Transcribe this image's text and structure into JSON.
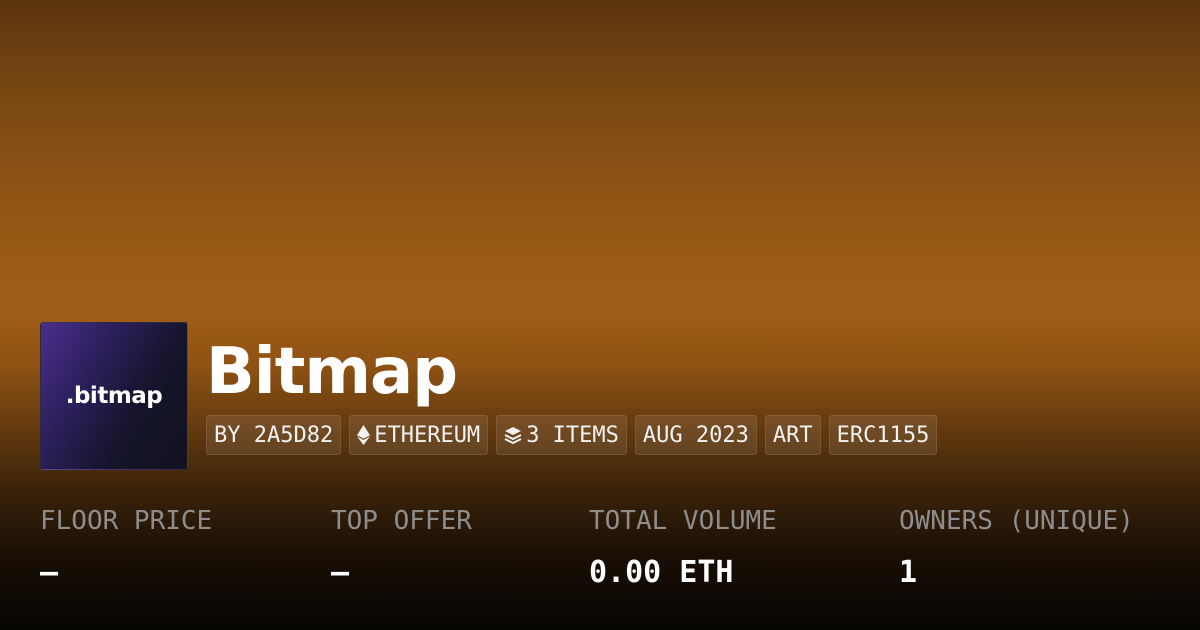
{
  "collection": {
    "logo_text": ".bitmap",
    "name": "Bitmap"
  },
  "tags": {
    "creator": "BY 2A5D82",
    "chain": "ETHEREUM",
    "chain_icon": "ethereum-icon",
    "items": "3 ITEMS",
    "items_icon": "layers-icon",
    "date": "AUG 2023",
    "category": "ART",
    "standard": "ERC1155"
  },
  "stats": {
    "floor_price": {
      "label": "FLOOR PRICE",
      "value": "–"
    },
    "top_offer": {
      "label": "TOP OFFER",
      "value": "–"
    },
    "total_volume": {
      "label": "TOTAL VOLUME",
      "value": "0.00 ETH"
    },
    "owners": {
      "label": "OWNERS (UNIQUE)",
      "value": "1"
    }
  },
  "colors": {
    "background_top": "#5a330d",
    "background_mid": "#a05d16",
    "background_bottom": "#070503",
    "label_gray": "#8d8d8d",
    "logo_purple": "#4b2f8c"
  }
}
